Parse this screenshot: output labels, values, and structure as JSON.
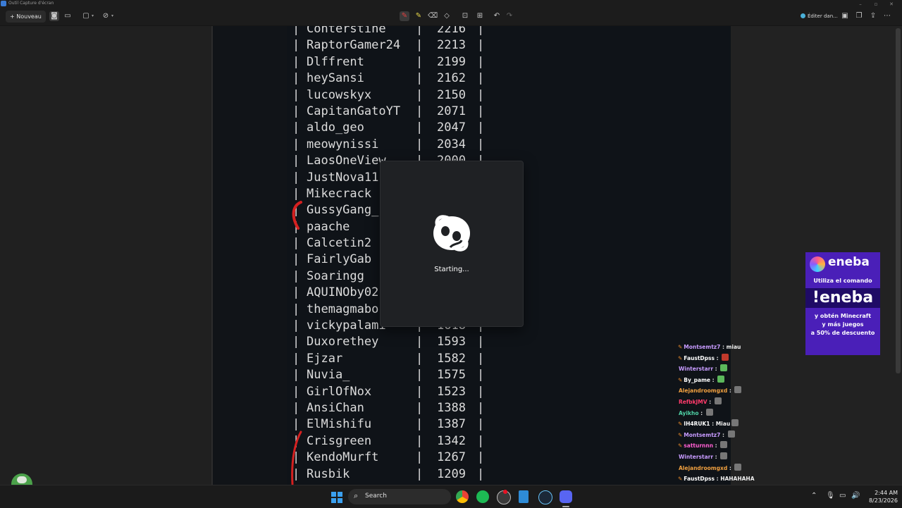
{
  "window": {
    "title": "Outil Capture d'écran"
  },
  "toolbar": {
    "new_label": "Nouveau",
    "edit_label": "Éditer dan..."
  },
  "leaderboard": [
    {
      "name": "Conterstine",
      "score": "2216"
    },
    {
      "name": "RaptorGamer24",
      "score": "2213"
    },
    {
      "name": "Dlffrent",
      "score": "2199"
    },
    {
      "name": "heySansi",
      "score": "2162"
    },
    {
      "name": "lucowskyx",
      "score": "2150"
    },
    {
      "name": "CapitanGatoYT",
      "score": "2071"
    },
    {
      "name": "aldo_geo",
      "score": "2047"
    },
    {
      "name": "meowynissi",
      "score": "2034"
    },
    {
      "name": "LaosOneView",
      "score": "2000"
    },
    {
      "name": "JustNova11",
      "score": ""
    },
    {
      "name": "Mikecrack",
      "score": ""
    },
    {
      "name": "GussyGang_",
      "score": ""
    },
    {
      "name": "paache",
      "score": ""
    },
    {
      "name": "Calcetin2",
      "score": ""
    },
    {
      "name": "FairlyGab",
      "score": ""
    },
    {
      "name": "Soaringg",
      "score": ""
    },
    {
      "name": "AQUINOby02",
      "score": ""
    },
    {
      "name": "themagmabo",
      "score": ""
    },
    {
      "name": "vickypalami",
      "score": "1618"
    },
    {
      "name": "Duxorethey",
      "score": "1593"
    },
    {
      "name": "Ejzar",
      "score": "1582"
    },
    {
      "name": "Nuvia_",
      "score": "1575"
    },
    {
      "name": "GirlOfNox",
      "score": "1523"
    },
    {
      "name": "AnsiChan",
      "score": "1388"
    },
    {
      "name": "ElMishifu",
      "score": "1387"
    },
    {
      "name": "Crisgreen",
      "score": "1342"
    },
    {
      "name": "KendoMurft",
      "score": "1267"
    },
    {
      "name": "Rusbik",
      "score": "1209"
    }
  ],
  "ad": {
    "brand": "eneba",
    "line1": "Utiliza el comando",
    "command": "!eneba",
    "line2a": "y obtén Minecraft",
    "line2b": "y más juegos",
    "line2c": "a 50% de descuento"
  },
  "chat": [
    {
      "user": "Montsemtz7",
      "color": "#c79bff",
      "text": "miau",
      "pencil": true,
      "emote": ""
    },
    {
      "user": "FaustDpss",
      "color": "#ffffff",
      "text": "",
      "pencil": true,
      "emote": "#c0392b"
    },
    {
      "user": "Winterstarr",
      "color": "#c79bff",
      "text": "",
      "pencil": false,
      "emote": "#5cb85c"
    },
    {
      "user": "By_pame",
      "color": "#ffffff",
      "text": "",
      "pencil": true,
      "emote": "#5cb85c"
    },
    {
      "user": "Alejandroomgxd",
      "color": "#f0a040",
      "text": "",
      "pencil": false,
      "emote": "#777777"
    },
    {
      "user": "RefbkJMV",
      "color": "#ff3b6b",
      "text": "",
      "pencil": false,
      "emote": "#777777"
    },
    {
      "user": "Ayikho",
      "color": "#4fd1a5",
      "text": "",
      "pencil": false,
      "emote": "#777777"
    },
    {
      "user": "IH4RUK1",
      "color": "#ffffff",
      "text": "Miau",
      "pencil": true,
      "emote": "#777777"
    },
    {
      "user": "Montsemtz7",
      "color": "#c79bff",
      "text": "",
      "pencil": true,
      "emote": "#777777"
    },
    {
      "user": "satturnnn",
      "color": "#ff5fd2",
      "text": "",
      "pencil": true,
      "emote": "#777777"
    },
    {
      "user": "Winterstarr",
      "color": "#c79bff",
      "text": "",
      "pencil": false,
      "emote": "#777777"
    },
    {
      "user": "Alejandroomgxd",
      "color": "#f0a040",
      "text": "",
      "pencil": false,
      "emote": "#777777"
    },
    {
      "user": "FaustDpss",
      "color": "#ffffff",
      "text": "HAHAHAHA",
      "pencil": true,
      "emote": ""
    }
  ],
  "splash": {
    "status": "Starting..."
  },
  "taskbar": {
    "search_label": "Search",
    "time": "2:44 AM",
    "date": "8/23/2026"
  }
}
